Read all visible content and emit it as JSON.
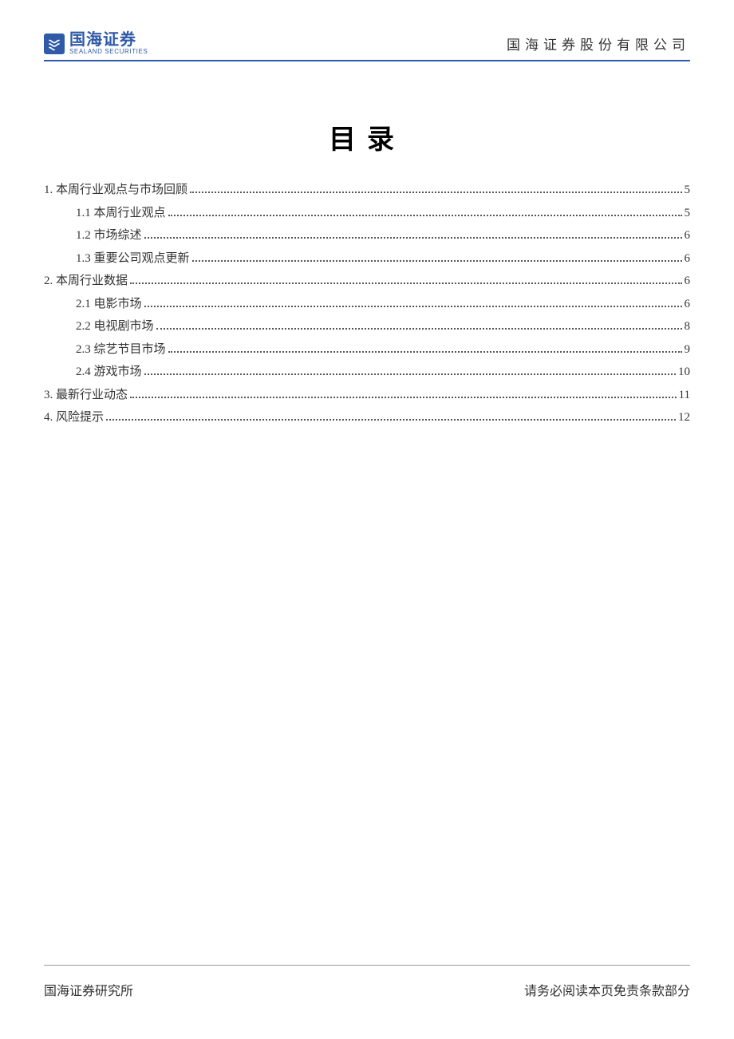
{
  "header": {
    "logo_cn": "国海证券",
    "logo_en": "SEALAND SECURITIES",
    "company_name": "国海证券股份有限公司"
  },
  "title": "目录",
  "toc": [
    {
      "level": 1,
      "label": "1. 本周行业观点与市场回顾",
      "page": "5"
    },
    {
      "level": 2,
      "label": "1.1 本周行业观点",
      "page": "5"
    },
    {
      "level": 2,
      "label": "1.2 市场综述",
      "page": "6"
    },
    {
      "level": 2,
      "label": "1.3 重要公司观点更新",
      "page": "6"
    },
    {
      "level": 1,
      "label": "2. 本周行业数据",
      "page": "6"
    },
    {
      "level": 2,
      "label": "2.1 电影市场",
      "page": "6"
    },
    {
      "level": 2,
      "label": "2.2 电视剧市场",
      "page": "8"
    },
    {
      "level": 2,
      "label": "2.3 综艺节目市场",
      "page": "9"
    },
    {
      "level": 2,
      "label": "2.4 游戏市场",
      "page": "10"
    },
    {
      "level": 1,
      "label": "3. 最新行业动态",
      "page": "11"
    },
    {
      "level": 1,
      "label": "4. 风险提示",
      "page": "12"
    }
  ],
  "footer": {
    "left": "国海证券研究所",
    "right": "请务必阅读本页免责条款部分"
  }
}
